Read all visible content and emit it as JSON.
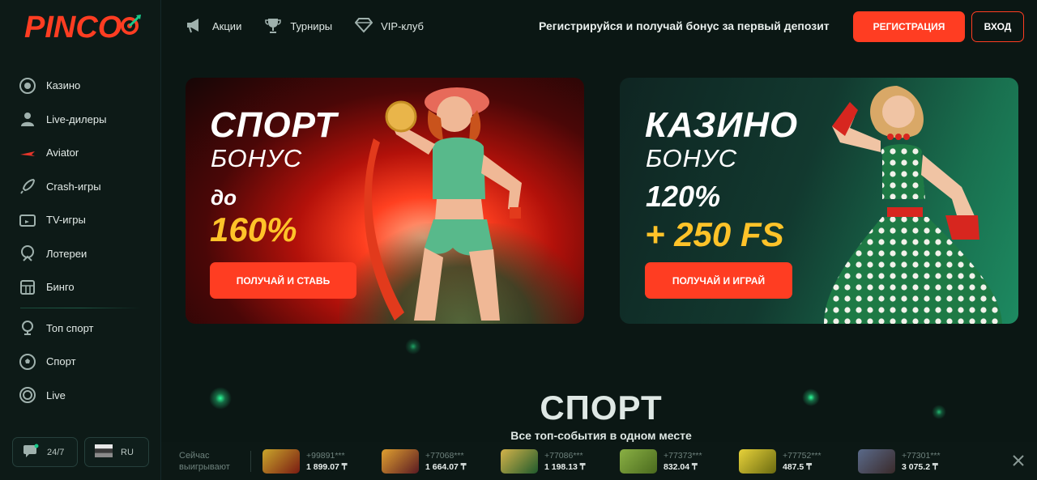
{
  "brand": {
    "logo_text": "PINCO"
  },
  "sidebar": {
    "items": [
      {
        "label": "Казино",
        "icon": "casino-chip-icon"
      },
      {
        "label": "Live-дилеры",
        "icon": "dealer-icon"
      },
      {
        "label": "Aviator",
        "icon": "plane-icon"
      },
      {
        "label": "Crash-игры",
        "icon": "rocket-icon"
      },
      {
        "label": "TV-игры",
        "icon": "tv-icon"
      },
      {
        "label": "Лотереи",
        "icon": "lottery-icon"
      },
      {
        "label": "Бинго",
        "icon": "bingo-icon"
      }
    ],
    "sport_items": [
      {
        "label": "Топ спорт",
        "icon": "trophy-ball-icon"
      },
      {
        "label": "Спорт",
        "icon": "soccer-ball-icon"
      },
      {
        "label": "Live",
        "icon": "live-icon"
      }
    ],
    "support_label": "24/7",
    "language_label": "RU"
  },
  "header": {
    "nav": [
      {
        "label": "Акции",
        "icon": "megaphone-icon"
      },
      {
        "label": "Турниры",
        "icon": "cup-icon"
      },
      {
        "label": "VIP-клуб",
        "icon": "diamond-icon"
      }
    ],
    "promo_text": "Регистрируйся и получай бонус за первый депозит",
    "register_label": "РЕГИСТРАЦИЯ",
    "login_label": "ВХОД"
  },
  "banners": {
    "sport": {
      "title": "СПОРТ",
      "subtitle": "БОНУС",
      "prefix": "до",
      "value": "160%",
      "button": "ПОЛУЧАЙ И СТАВЬ"
    },
    "casino": {
      "title": "КАЗИНО",
      "subtitle": "БОНУС",
      "prefix": "120%",
      "value": "+ 250 FS",
      "button": "ПОЛУЧАЙ И ИГРАЙ"
    }
  },
  "sport_section": {
    "title": "СПОРТ",
    "subtitle": "Все топ-события в одном месте"
  },
  "ticker": {
    "label_line1": "Сейчас",
    "label_line2": "выигрывают",
    "wins": [
      {
        "user": "+99891***",
        "amount": "1 899.07 ₸",
        "color": "#7a1b12"
      },
      {
        "user": "+77068***",
        "amount": "1 664.07 ₸",
        "color": "#5a1a22"
      },
      {
        "user": "+77086***",
        "amount": "1 198.13 ₸",
        "color": "#1f5a2c"
      },
      {
        "user": "+77373***",
        "amount": "832.04 ₸",
        "color": "#4a6a1e"
      },
      {
        "user": "+77752***",
        "amount": "487.5 ₸",
        "color": "#6a6a10"
      },
      {
        "user": "+77301***",
        "amount": "3 075.2 ₸",
        "color": "#3a2a2a"
      }
    ]
  },
  "colors": {
    "accent": "#ff3d22",
    "gold": "#ffc329",
    "bg": "#0b1714"
  }
}
